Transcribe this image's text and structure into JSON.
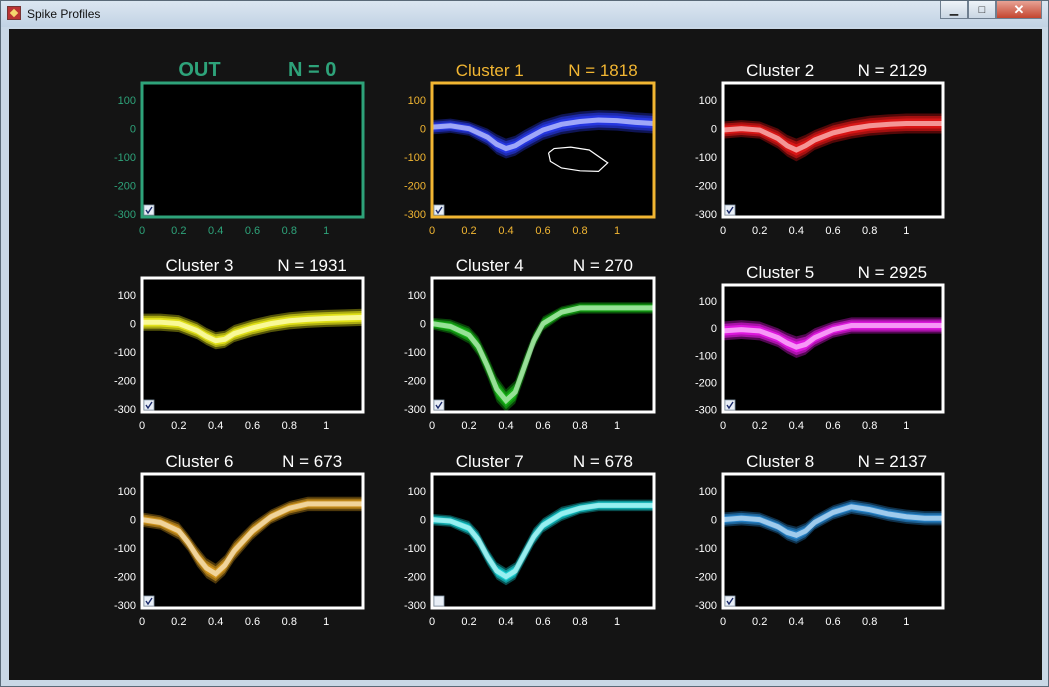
{
  "window": {
    "title": "Spike Profiles",
    "minimize_label": "▁",
    "maximize_label": "□",
    "close_label": "✕"
  },
  "colors": {
    "figure_background": "#141414",
    "axes_background": "#000000",
    "default_frame": "#ffffff",
    "out_frame": "#2ea37a",
    "selected_frame": "#f2b632",
    "tick_text_default": "#ffffff"
  },
  "chart_data": [
    {
      "type": "line",
      "name": "OUT",
      "title": "OUT",
      "count_label": "N = 0",
      "color": "#2ea37a",
      "frame": "out",
      "title_bold": true,
      "checkbox_checked": true,
      "x": [],
      "mean": [],
      "spread": [],
      "xlim": [
        0,
        1.2
      ],
      "ylim": [
        -310,
        160
      ],
      "xticks": [
        0,
        0.2,
        0.4,
        0.6,
        0.8,
        1
      ],
      "yticks": [
        100,
        0,
        -100,
        -200,
        -300
      ]
    },
    {
      "type": "line",
      "name": "Cluster 1",
      "title": "Cluster 1",
      "count_label": "N = 1818",
      "color": "#2a3cf0",
      "frame": "selected",
      "checkbox_checked": true,
      "x": [
        0,
        0.1,
        0.2,
        0.3,
        0.35,
        0.4,
        0.45,
        0.5,
        0.6,
        0.7,
        0.8,
        0.9,
        1.0,
        1.1,
        1.2
      ],
      "mean": [
        5,
        10,
        0,
        -30,
        -55,
        -70,
        -60,
        -40,
        -5,
        15,
        25,
        30,
        28,
        22,
        18
      ],
      "spread": [
        25,
        25,
        25,
        30,
        35,
        35,
        35,
        35,
        35,
        35,
        35,
        35,
        35,
        35,
        35
      ],
      "lasso": [
        [
          0.63,
          -85
        ],
        [
          0.66,
          -70
        ],
        [
          0.75,
          -65
        ],
        [
          0.85,
          -75
        ],
        [
          0.95,
          -120
        ],
        [
          0.9,
          -150
        ],
        [
          0.8,
          -148
        ],
        [
          0.7,
          -138
        ],
        [
          0.64,
          -115
        ],
        [
          0.63,
          -85
        ]
      ],
      "xlim": [
        0,
        1.2
      ],
      "ylim": [
        -310,
        160
      ],
      "xticks": [
        0,
        0.2,
        0.4,
        0.6,
        0.8,
        1
      ],
      "yticks": [
        100,
        0,
        -100,
        -200,
        -300
      ]
    },
    {
      "type": "line",
      "name": "Cluster 2",
      "title": "Cluster 2",
      "count_label": "N = 2129",
      "color": "#e81818",
      "frame": "default",
      "checkbox_checked": true,
      "x": [
        0,
        0.1,
        0.2,
        0.3,
        0.35,
        0.4,
        0.45,
        0.5,
        0.6,
        0.7,
        0.8,
        0.9,
        1.0,
        1.1,
        1.2
      ],
      "mean": [
        -5,
        0,
        -5,
        -35,
        -60,
        -75,
        -60,
        -40,
        -15,
        0,
        10,
        15,
        18,
        18,
        18
      ],
      "spread": [
        30,
        30,
        30,
        35,
        38,
        40,
        38,
        35,
        35,
        35,
        35,
        35,
        35,
        35,
        35
      ],
      "xlim": [
        0,
        1.2
      ],
      "ylim": [
        -310,
        160
      ],
      "xticks": [
        0,
        0.2,
        0.4,
        0.6,
        0.8,
        1
      ],
      "yticks": [
        100,
        0,
        -100,
        -200,
        -300
      ]
    },
    {
      "type": "line",
      "name": "Cluster 3",
      "title": "Cluster 3",
      "count_label": "N = 1931",
      "color": "#f2f21a",
      "frame": "default",
      "checkbox_checked": true,
      "x": [
        0,
        0.1,
        0.2,
        0.3,
        0.35,
        0.4,
        0.45,
        0.5,
        0.6,
        0.7,
        0.8,
        0.9,
        1.0,
        1.1,
        1.2
      ],
      "mean": [
        5,
        5,
        0,
        -25,
        -45,
        -60,
        -55,
        -35,
        -15,
        0,
        10,
        15,
        18,
        20,
        22
      ],
      "spread": [
        30,
        30,
        30,
        30,
        30,
        30,
        30,
        30,
        30,
        30,
        30,
        30,
        30,
        30,
        30
      ],
      "xlim": [
        0,
        1.2
      ],
      "ylim": [
        -310,
        160
      ],
      "xticks": [
        0,
        0.2,
        0.4,
        0.6,
        0.8,
        1
      ],
      "yticks": [
        100,
        0,
        -100,
        -200,
        -300
      ]
    },
    {
      "type": "line",
      "name": "Cluster 4",
      "title": "Cluster 4",
      "count_label": "N = 270",
      "color": "#18c018",
      "frame": "default",
      "checkbox_checked": true,
      "x": [
        0,
        0.1,
        0.2,
        0.25,
        0.3,
        0.35,
        0.4,
        0.45,
        0.5,
        0.55,
        0.6,
        0.7,
        0.8,
        0.9,
        1.0,
        1.1,
        1.2
      ],
      "mean": [
        0,
        -10,
        -40,
        -80,
        -150,
        -230,
        -270,
        -240,
        -150,
        -60,
        0,
        40,
        55,
        55,
        55,
        55,
        55
      ],
      "spread": [
        20,
        25,
        30,
        35,
        40,
        45,
        40,
        40,
        40,
        30,
        25,
        20,
        20,
        20,
        20,
        20,
        20
      ],
      "xlim": [
        0,
        1.2
      ],
      "ylim": [
        -310,
        160
      ],
      "xticks": [
        0,
        0.2,
        0.4,
        0.6,
        0.8,
        1
      ],
      "yticks": [
        100,
        0,
        -100,
        -200,
        -300
      ]
    },
    {
      "type": "line",
      "name": "Cluster 5",
      "title": "Cluster 5",
      "count_label": "N = 2925",
      "color": "#ee1aee",
      "frame": "default",
      "checkbox_checked": true,
      "x": [
        0,
        0.1,
        0.2,
        0.3,
        0.35,
        0.4,
        0.45,
        0.5,
        0.6,
        0.7,
        0.8,
        0.9,
        1.0,
        1.1,
        1.2
      ],
      "mean": [
        -10,
        -5,
        -10,
        -35,
        -55,
        -70,
        -60,
        -35,
        -5,
        10,
        10,
        10,
        10,
        10,
        10
      ],
      "spread": [
        35,
        35,
        35,
        35,
        38,
        40,
        38,
        35,
        30,
        30,
        30,
        30,
        30,
        30,
        30
      ],
      "xlim": [
        0,
        1.2
      ],
      "ylim": [
        -310,
        160
      ],
      "xticks": [
        0,
        0.2,
        0.4,
        0.6,
        0.8,
        1
      ],
      "yticks": [
        100,
        0,
        -100,
        -200,
        -300
      ]
    },
    {
      "type": "line",
      "name": "Cluster 6",
      "title": "Cluster 6",
      "count_label": "N = 673",
      "color": "#e0a020",
      "frame": "default",
      "checkbox_checked": true,
      "x": [
        0,
        0.1,
        0.2,
        0.25,
        0.3,
        0.35,
        0.4,
        0.45,
        0.5,
        0.6,
        0.7,
        0.8,
        0.9,
        1.0,
        1.1,
        1.2
      ],
      "mean": [
        0,
        -10,
        -40,
        -80,
        -130,
        -170,
        -190,
        -160,
        -110,
        -40,
        10,
        40,
        55,
        55,
        55,
        55
      ],
      "spread": [
        25,
        25,
        30,
        30,
        35,
        35,
        35,
        35,
        35,
        30,
        25,
        25,
        25,
        25,
        25,
        25
      ],
      "xlim": [
        0,
        1.2
      ],
      "ylim": [
        -310,
        160
      ],
      "xticks": [
        0,
        0.2,
        0.4,
        0.6,
        0.8,
        1
      ],
      "yticks": [
        100,
        0,
        -100,
        -200,
        -300
      ]
    },
    {
      "type": "line",
      "name": "Cluster 7",
      "title": "Cluster 7",
      "count_label": "N = 678",
      "color": "#18dde0",
      "frame": "default",
      "checkbox_checked": false,
      "x": [
        0,
        0.1,
        0.2,
        0.25,
        0.3,
        0.35,
        0.4,
        0.45,
        0.5,
        0.55,
        0.6,
        0.7,
        0.8,
        0.9,
        1.0,
        1.1,
        1.2
      ],
      "mean": [
        0,
        -5,
        -30,
        -70,
        -130,
        -180,
        -200,
        -180,
        -120,
        -60,
        -20,
        20,
        40,
        50,
        50,
        50,
        50
      ],
      "spread": [
        20,
        20,
        25,
        30,
        30,
        30,
        30,
        30,
        30,
        30,
        25,
        25,
        20,
        20,
        20,
        20,
        20
      ],
      "xlim": [
        0,
        1.2
      ],
      "ylim": [
        -310,
        160
      ],
      "xticks": [
        0,
        0.2,
        0.4,
        0.6,
        0.8,
        1
      ],
      "yticks": [
        100,
        0,
        -100,
        -200,
        -300
      ]
    },
    {
      "type": "line",
      "name": "Cluster 8",
      "title": "Cluster 8",
      "count_label": "N = 2137",
      "color": "#2a8cd8",
      "frame": "default",
      "checkbox_checked": true,
      "x": [
        0,
        0.1,
        0.2,
        0.3,
        0.35,
        0.4,
        0.45,
        0.5,
        0.6,
        0.7,
        0.8,
        0.9,
        1.0,
        1.1,
        1.2
      ],
      "mean": [
        0,
        5,
        0,
        -25,
        -45,
        -55,
        -40,
        -10,
        25,
        45,
        35,
        20,
        10,
        5,
        5
      ],
      "spread": [
        25,
        25,
        25,
        25,
        28,
        30,
        28,
        25,
        25,
        25,
        25,
        25,
        25,
        25,
        25
      ],
      "xlim": [
        0,
        1.2
      ],
      "ylim": [
        -310,
        160
      ],
      "xticks": [
        0,
        0.2,
        0.4,
        0.6,
        0.8,
        1
      ],
      "yticks": [
        100,
        0,
        -100,
        -200,
        -300
      ]
    }
  ]
}
